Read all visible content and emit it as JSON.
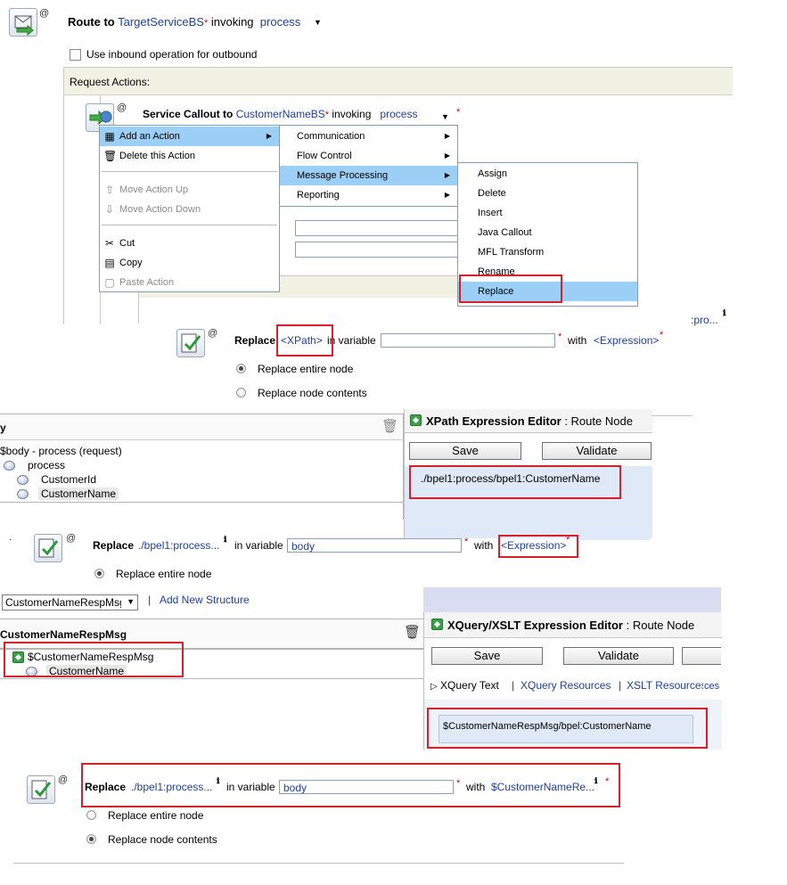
{
  "route": {
    "prefix": "Route to",
    "service": "TargetServiceBS",
    "invoking": "invoking",
    "operation": "process",
    "checkbox_label": "Use inbound operation for outbound"
  },
  "request_actions": {
    "title": "Request Actions:"
  },
  "service_callout": {
    "prefix": "Service Callout to",
    "service": "CustomerNameBS",
    "invoking": "invoking",
    "operation": "process"
  },
  "context_menu": {
    "add_action": "Add an Action",
    "delete_action": "Delete this Action",
    "move_up": "Move Action Up",
    "move_down": "Move Action Down",
    "cut": "Cut",
    "copy": "Copy",
    "paste": "Paste Action"
  },
  "submenu": {
    "communication": "Communication",
    "flow_control": "Flow Control",
    "message_processing": "Message Processing",
    "reporting": "Reporting"
  },
  "message_processing_menu": {
    "assign": "Assign",
    "delete": "Delete",
    "insert": "Insert",
    "java_callout": "Java Callout",
    "mfl_transform": "MFL Transform",
    "rename": "Rename",
    "replace": "Replace"
  },
  "truncated_right": ":pro...",
  "replace1": {
    "replace": "Replace",
    "xpath": "<XPath>",
    "in_variable": "in variable",
    "with": "with",
    "expression": "<Expression>",
    "opt_entire": "Replace entire node",
    "opt_contents": "Replace node contents"
  },
  "var_panel1": {
    "header": "y",
    "root": "$body - process (request)",
    "process": "process",
    "customer_id": "CustomerId",
    "customer_name": "CustomerName"
  },
  "xpath_editor": {
    "title": "XPath Expression Editor",
    "subtitle": "Route Node",
    "save": "Save",
    "validate": "Validate",
    "expression": "./bpel1:process/bpel1:CustomerName"
  },
  "replace2": {
    "replace": "Replace",
    "xpath": "./bpel1:process...",
    "in_variable": "in variable",
    "variable": "body",
    "with": "with",
    "expression": "<Expression>",
    "opt_entire": "Replace entire node"
  },
  "structure": {
    "select_value": "CustomerNameRespMsg",
    "separator": "|",
    "add_new": "Add New Structure",
    "header": "CustomerNameRespMsg",
    "root": "$CustomerNameRespMsg",
    "child": "CustomerName"
  },
  "xquery_editor": {
    "title": "XQuery/XSLT Expression Editor",
    "subtitle": "Route Node",
    "save": "Save",
    "validate": "Validate",
    "tab_xquery_text": "XQuery Text",
    "tab_xquery_res": "XQuery Resources",
    "tab_xslt_res": "XSLT Resources",
    "tab_truncated": "ces",
    "expression": "$CustomerNameRespMsg/bpel:CustomerName"
  },
  "replace3": {
    "replace": "Replace",
    "xpath": "./bpel1:process...",
    "in_variable": "in variable",
    "variable": "body",
    "with": "with",
    "expression": "$CustomerNameRe...",
    "opt_entire": "Replace entire node",
    "opt_contents": "Replace node contents"
  },
  "colors": {
    "link": "#1f3ea8",
    "highlight": "#9ccff6",
    "annotation": "#d9202a",
    "header_bg": "#f1f1e4"
  }
}
